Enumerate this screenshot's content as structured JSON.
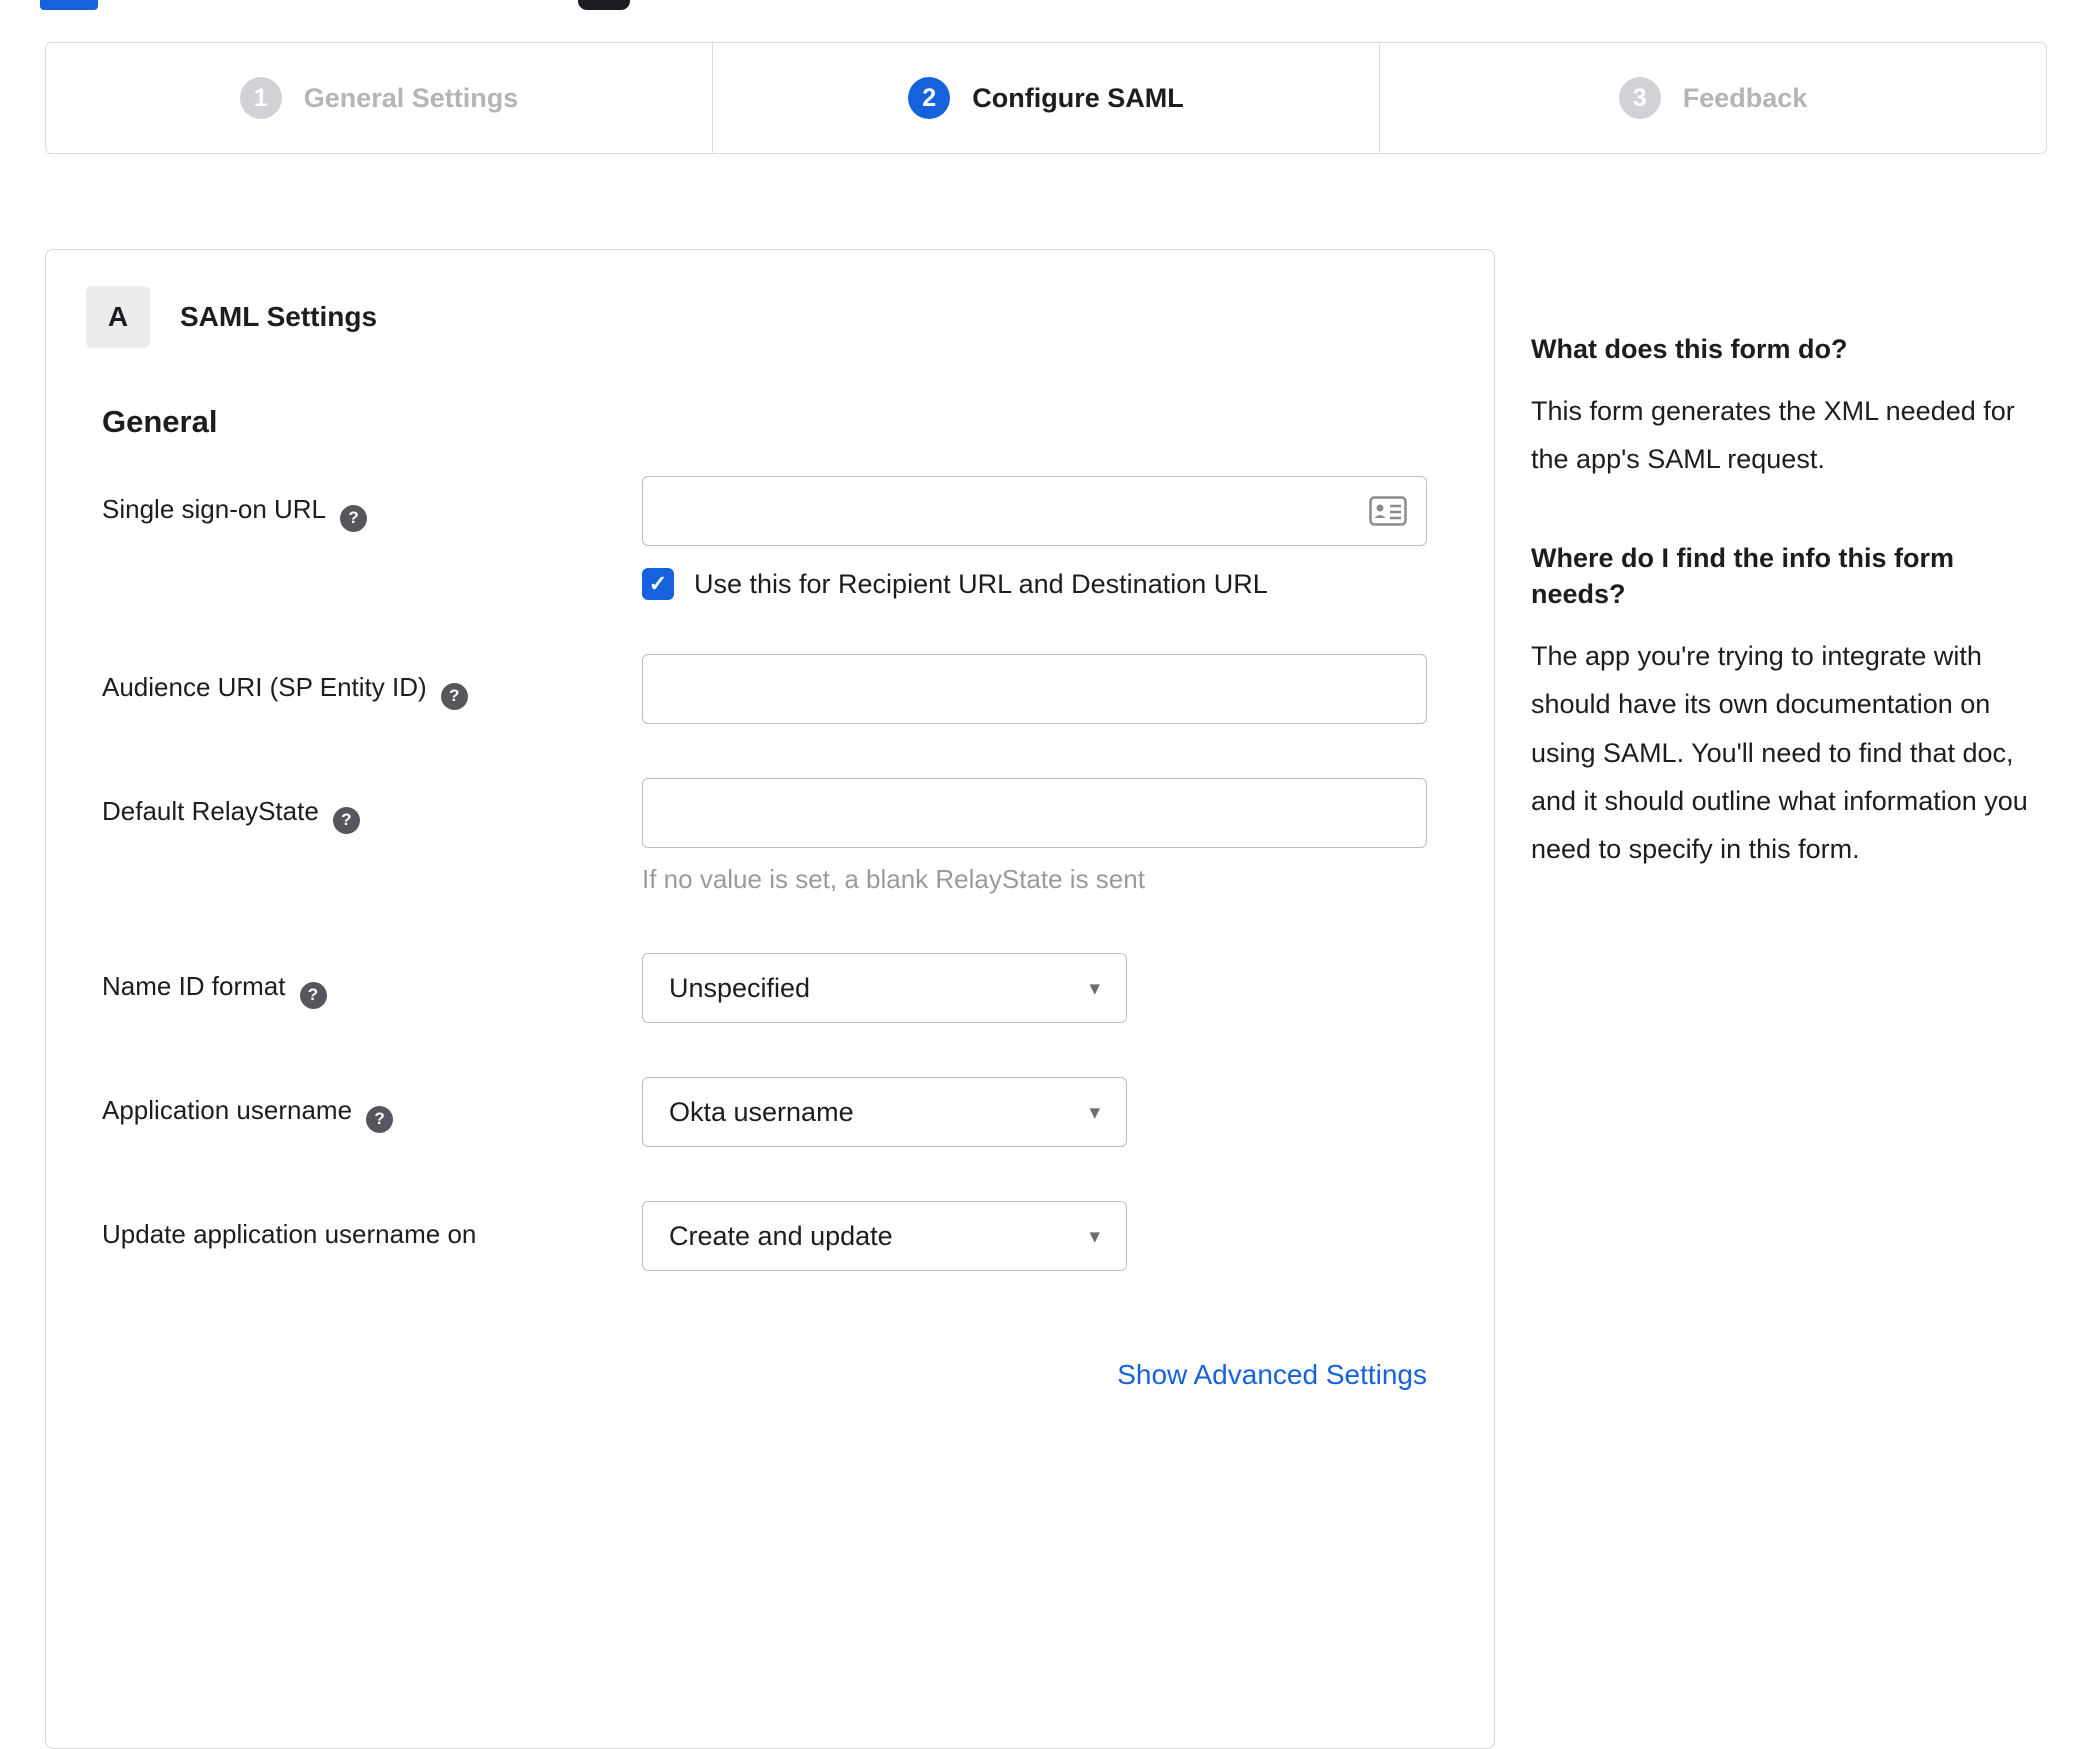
{
  "colors": {
    "accent": "#1662dd",
    "link": "#1662dd"
  },
  "icons": {
    "help": "?",
    "caret": "▾",
    "check": "✓"
  },
  "stepper": {
    "steps": [
      {
        "number": "1",
        "label": "General Settings"
      },
      {
        "number": "2",
        "label": "Configure SAML"
      },
      {
        "number": "3",
        "label": "Feedback"
      }
    ]
  },
  "panel": {
    "badge": "A",
    "title": "SAML Settings",
    "group": "General",
    "fields": {
      "sso_url": {
        "label": "Single sign-on URL",
        "value": "",
        "checkbox_label": "Use this for Recipient URL and Destination URL",
        "checkbox_checked": true
      },
      "audience_uri": {
        "label": "Audience URI (SP Entity ID)",
        "value": ""
      },
      "relay_state": {
        "label": "Default RelayState",
        "value": "",
        "hint": "If no value is set, a blank RelayState is sent"
      },
      "name_id_format": {
        "label": "Name ID format",
        "value": "Unspecified"
      },
      "app_username": {
        "label": "Application username",
        "value": "Okta username"
      },
      "update_username": {
        "label": "Update application username on",
        "value": "Create and update"
      }
    },
    "advanced_link": "Show Advanced Settings"
  },
  "sidebar": {
    "block1": {
      "heading": "What does this form do?",
      "body": "This form generates the XML needed for the app's SAML request."
    },
    "block2": {
      "heading": "Where do I find the info this form needs?",
      "body": "The app you're trying to integrate with should have its own documentation on using SAML. You'll need to find that doc, and it should outline what information you need to specify in this form."
    }
  }
}
